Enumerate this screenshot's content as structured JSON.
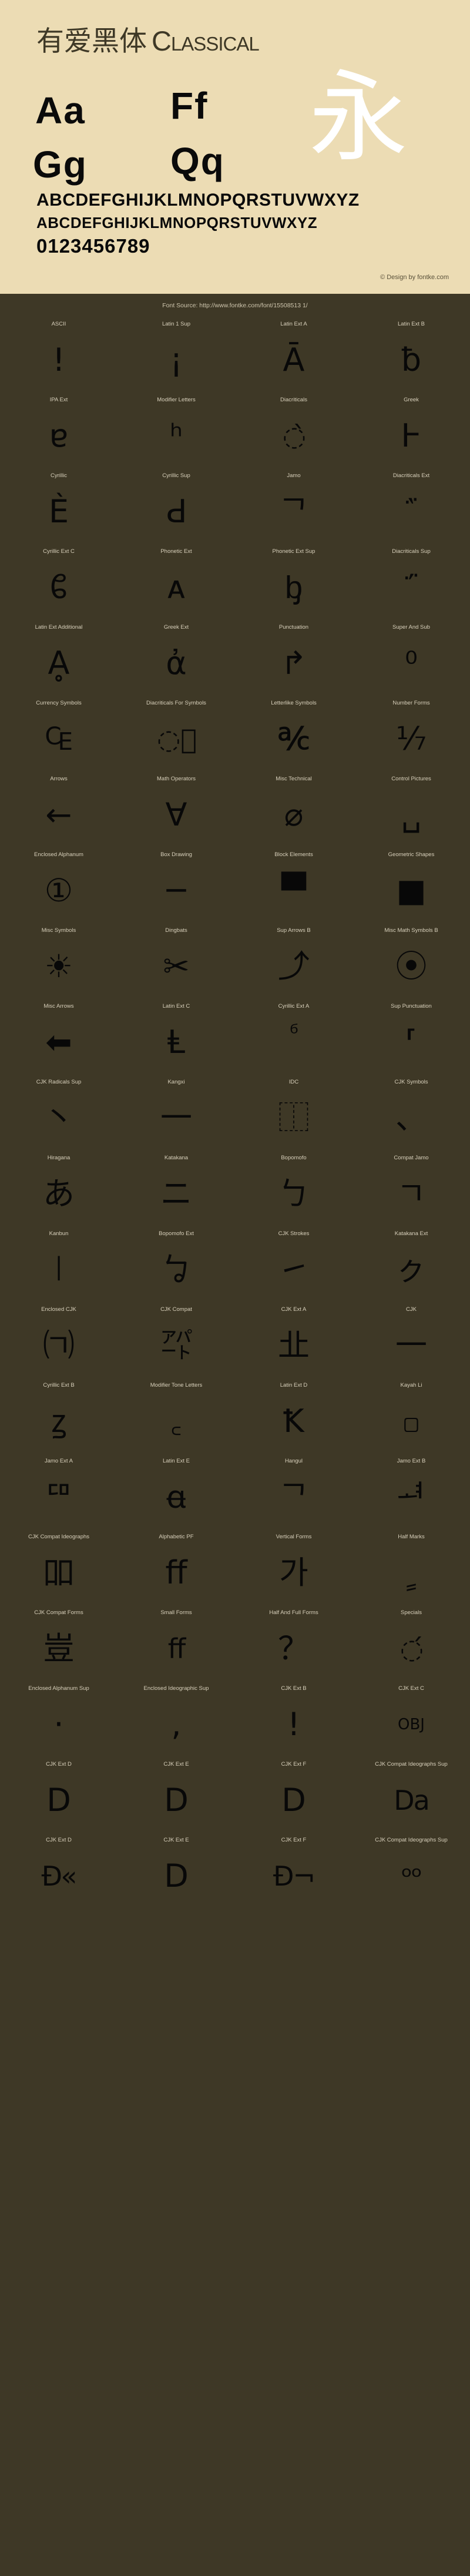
{
  "specimen": {
    "title_cjk": "有爱黑体",
    "title_latin": "Classical",
    "glyph_pairs": [
      "Aa",
      "Ff",
      "Gg",
      "Qq"
    ],
    "showcase_char": "永",
    "alphabet_upper_1": "ABCDEFGHIJKLMNOPQRSTUVWXYZ",
    "alphabet_upper_2": "ABCDEFGHIJKLMNOPQRSTUVWXYZ",
    "digits": "0123456789",
    "credit": "© Design by fontke.com"
  },
  "source_bar": {
    "text": "Font Source: http://www.fontke.com/font/15508513 1/"
  },
  "blocks": [
    {
      "label": "ASCII",
      "sample": "!"
    },
    {
      "label": "Latin 1 Sup",
      "sample": "¡"
    },
    {
      "label": "Latin Ext A",
      "sample": "Ā"
    },
    {
      "label": "Latin Ext B",
      "sample": "ƀ"
    },
    {
      "label": "IPA Ext",
      "sample": "ɐ"
    },
    {
      "label": "Modifier Letters",
      "sample": "ʰ"
    },
    {
      "label": "Diacriticals",
      "sample": "◌̀"
    },
    {
      "label": "Greek",
      "sample": "Ͱ"
    },
    {
      "label": "Cyrillic",
      "sample": "Ѐ"
    },
    {
      "label": "Cyrillic Sup",
      "sample": "Ԁ"
    },
    {
      "label": "Jamo",
      "sample": "ᄀ"
    },
    {
      "label": "Diacriticals Ext",
      "sample": "᷀"
    },
    {
      "label": "Cyrillic Ext C",
      "sample": "ᲀ"
    },
    {
      "label": "Phonetic Ext",
      "sample": "ᴀ"
    },
    {
      "label": "Phonetic Ext Sup",
      "sample": "ᶀ"
    },
    {
      "label": "Diacriticals Sup",
      "sample": "᷁"
    },
    {
      "label": "Latin Ext Additional",
      "sample": "Ḁ"
    },
    {
      "label": "Greek Ext",
      "sample": "ἀ"
    },
    {
      "label": "Punctuation",
      "sample": "↱"
    },
    {
      "label": "Super And Sub",
      "sample": "⁰"
    },
    {
      "label": "Currency Symbols",
      "sample": "₠"
    },
    {
      "label": "Diacriticals For Symbols",
      "sample": "◌⃝"
    },
    {
      "label": "Letterlike Symbols",
      "sample": "℀"
    },
    {
      "label": "Number Forms",
      "sample": "⅐"
    },
    {
      "label": "Arrows",
      "sample": "←"
    },
    {
      "label": "Math Operators",
      "sample": "∀"
    },
    {
      "label": "Misc Technical",
      "sample": "⌀"
    },
    {
      "label": "Control Pictures",
      "sample": "␣"
    },
    {
      "label": "Enclosed Alphanum",
      "sample": "①"
    },
    {
      "label": "Box Drawing",
      "sample": "─"
    },
    {
      "label": "Block Elements",
      "sample": "▀"
    },
    {
      "label": "Geometric Shapes",
      "sample": "■"
    },
    {
      "label": "Misc Symbols",
      "sample": "☀"
    },
    {
      "label": "Dingbats",
      "sample": "✂"
    },
    {
      "label": "Sup Arrows B",
      "sample": "⤴"
    },
    {
      "label": "Misc Math Symbols B",
      "sample": "⦿"
    },
    {
      "label": "Misc Arrows",
      "sample": "⬅"
    },
    {
      "label": "Latin Ext C",
      "sample": "Ⱡ"
    },
    {
      "label": "Cyrillic Ext A",
      "sample": "ⷠ"
    },
    {
      "label": "Sup Punctuation",
      "sample": "⸢"
    },
    {
      "label": "CJK Radicals Sup",
      "sample": "⼂"
    },
    {
      "label": "Kangxi",
      "sample": "⼀"
    },
    {
      "label": "IDC",
      "sample": "⿰"
    },
    {
      "label": "CJK Symbols",
      "sample": "、"
    },
    {
      "label": "Hiragana",
      "sample": "あ"
    },
    {
      "label": "Katakana",
      "sample": "ニ"
    },
    {
      "label": "Bopomofo",
      "sample": "ㄅ"
    },
    {
      "label": "Compat Jamo",
      "sample": "ㄱ"
    },
    {
      "label": "Kanbun",
      "sample": "㆐"
    },
    {
      "label": "Bopomofo Ext",
      "sample": "ㆠ"
    },
    {
      "label": "CJK Strokes",
      "sample": "㇀"
    },
    {
      "label": "Katakana Ext",
      "sample": "ㇰ"
    },
    {
      "label": "Enclosed CJK",
      "sample": "㈀"
    },
    {
      "label": "CJK Compat",
      "sample": "㌀"
    },
    {
      "label": "CJK Ext A",
      "sample": "㐀"
    },
    {
      "label": "CJK",
      "sample": "一"
    },
    {
      "label": "Cyrillic Ext B",
      "sample": "ꙁ"
    },
    {
      "label": "Modifier Tone Letters",
      "sample": "꜀"
    },
    {
      "label": "Latin Ext D",
      "sample": "Ꝁ"
    },
    {
      "label": "Kayah Li",
      "sample": "꤀"
    },
    {
      "label": "Jamo Ext A",
      "sample": "ꥠ"
    },
    {
      "label": "Latin Ext E",
      "sample": "ꬰ"
    },
    {
      "label": "Hangul",
      "sample": "ᄀ"
    },
    {
      "label": "Jamo Ext B",
      "sample": "ힰ"
    },
    {
      "label": "CJK Compat Ideographs",
      "sample": "吅"
    },
    {
      "label": "Alphabetic PF",
      "sample": "ﬀ"
    },
    {
      "label": "Vertical Forms",
      "sample": "가"
    },
    {
      "label": "Half Marks",
      "sample": "ﹴ"
    },
    {
      "label": "CJK Compat Forms",
      "sample": "豈"
    },
    {
      "label": "Small Forms",
      "sample": "ff"
    },
    {
      "label": "Half And Full Forms",
      "sample": "？"
    },
    {
      "label": "Specials",
      "sample": "◌́"
    },
    {
      "label": "Enclosed Alphanum Sup",
      "sample": "·"
    },
    {
      "label": "Enclosed Ideographic Sup",
      "sample": ","
    },
    {
      "label": "CJK Ext B",
      "sample": "!"
    },
    {
      "label": "CJK Ext C",
      "sample": "OBJ"
    },
    {
      "label": "CJK Ext D",
      "sample": "D"
    },
    {
      "label": "CJK Ext E",
      "sample": "D"
    },
    {
      "label": "CJK Ext F",
      "sample": "D"
    },
    {
      "label": "CJK Compat Ideographs Sup",
      "sample": "Da"
    },
    {
      "label": "CJK Ext D",
      "sample": "Ð«"
    },
    {
      "label": "CJK Ext E",
      "sample": "D"
    },
    {
      "label": "CJK Ext F",
      "sample": "Ð¬"
    },
    {
      "label": "CJK Compat Ideographs Sup",
      "sample": "ᵒᵒ"
    }
  ]
}
